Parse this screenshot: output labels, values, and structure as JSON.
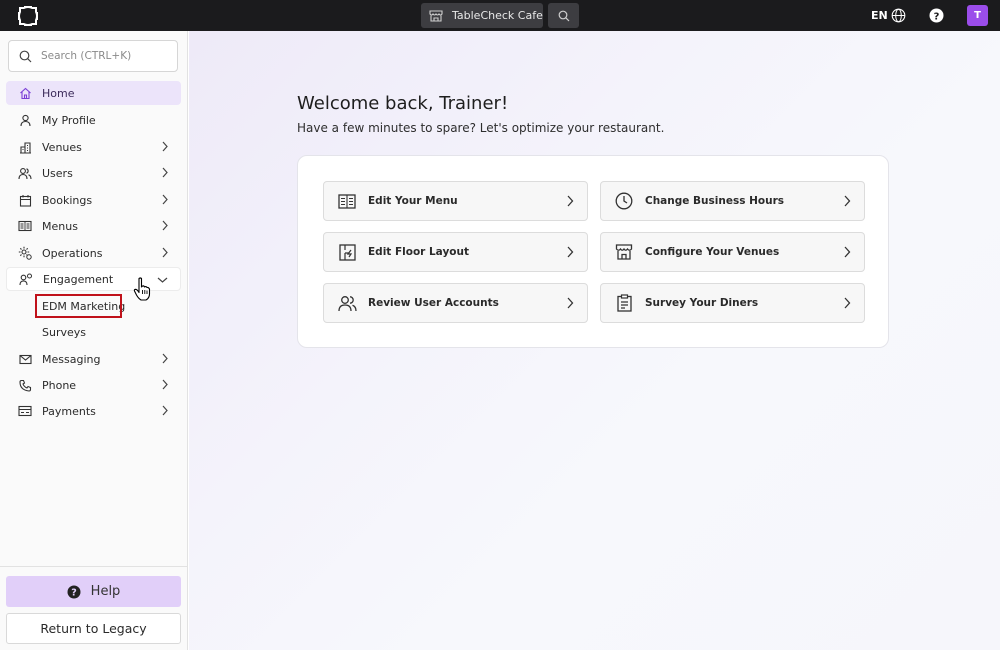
{
  "topbar": {
    "venue_label": "TableCheck Cafe",
    "language": "EN",
    "avatar_initial": "T"
  },
  "sidebar": {
    "search_placeholder": "Search (CTRL+K)",
    "items": [
      {
        "label": "Home",
        "icon": "home-icon",
        "active": true
      },
      {
        "label": "My Profile",
        "icon": "user-icon"
      },
      {
        "label": "Venues",
        "icon": "building-icon",
        "has_children": true
      },
      {
        "label": "Users",
        "icon": "users-icon",
        "has_children": true
      },
      {
        "label": "Bookings",
        "icon": "calendar-icon",
        "has_children": true
      },
      {
        "label": "Menus",
        "icon": "menu-book-icon",
        "has_children": true
      },
      {
        "label": "Operations",
        "icon": "gear-icon",
        "has_children": true
      },
      {
        "label": "Engagement",
        "icon": "engagement-icon",
        "expanded": true
      },
      {
        "label": "Messaging",
        "icon": "mail-icon",
        "has_children": true
      },
      {
        "label": "Phone",
        "icon": "phone-icon",
        "has_children": true
      },
      {
        "label": "Payments",
        "icon": "payment-icon",
        "has_children": true
      }
    ],
    "engagement_children": [
      "EDM Marketing",
      "Surveys"
    ],
    "help_label": "Help",
    "legacy_label": "Return to Legacy"
  },
  "main": {
    "welcome": "Welcome back, Trainer!",
    "subtitle": "Have a few minutes to spare? Let's optimize your restaurant.",
    "actions": [
      {
        "label": "Edit Your Menu",
        "icon": "menu-book-icon"
      },
      {
        "label": "Change Business Hours",
        "icon": "clock-icon"
      },
      {
        "label": "Edit Floor Layout",
        "icon": "floor-plan-icon"
      },
      {
        "label": "Configure Your Venues",
        "icon": "store-icon"
      },
      {
        "label": "Review User Accounts",
        "icon": "users-icon"
      },
      {
        "label": "Survey Your Diners",
        "icon": "clipboard-icon"
      }
    ]
  },
  "colors": {
    "topbar_bg": "#1b1b1d",
    "accent_purple": "#9b4dea",
    "active_nav_bg": "#ece4fa",
    "help_bg": "#e1cff9",
    "highlight_red": "#c0111a"
  }
}
